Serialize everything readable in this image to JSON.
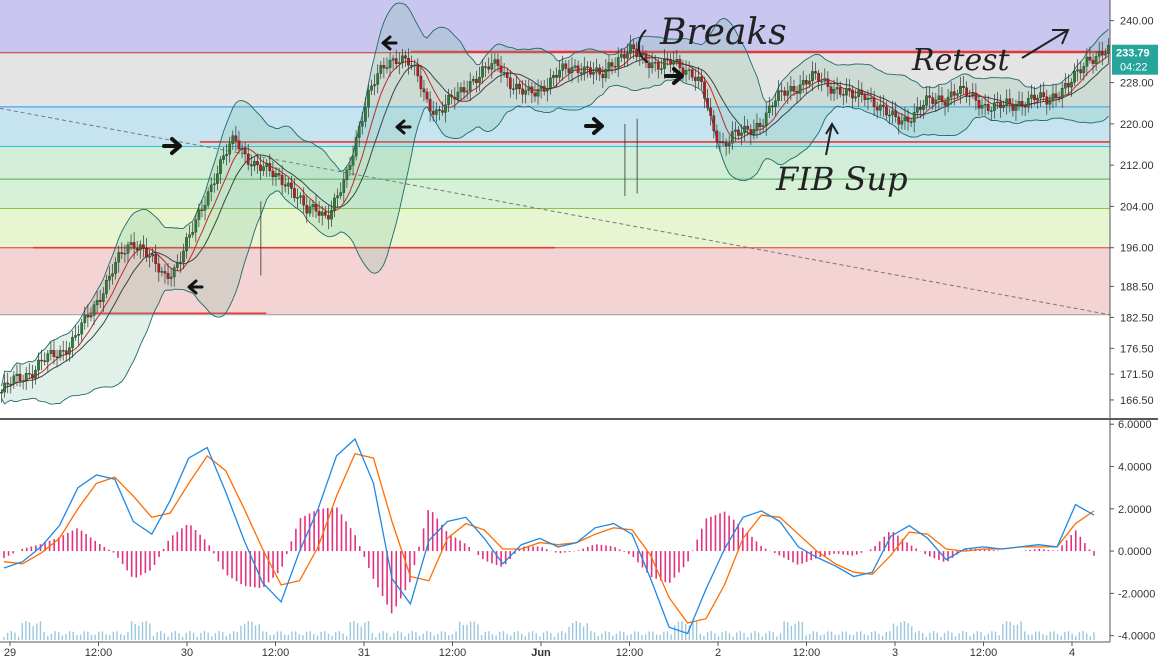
{
  "chart_data": {
    "type": "candlestick",
    "price_axis": {
      "range": [
        163.0,
        244.0
      ],
      "ticks": [
        "240.00",
        "228.00",
        "220.00",
        "212.00",
        "204.00",
        "196.00",
        "188.50",
        "182.50",
        "176.50",
        "171.50",
        "166.50"
      ],
      "tick_values": [
        240.0,
        228.0,
        220.0,
        212.0,
        204.0,
        196.0,
        188.5,
        182.5,
        176.5,
        171.5,
        166.5
      ]
    },
    "time_axis": {
      "ticks": [
        "29",
        "12:00",
        "30",
        "12:00",
        "31",
        "12:00",
        "Jun",
        "12:00",
        "2",
        "12:00",
        "3",
        "12:00",
        "4"
      ],
      "bold": [
        "Jun"
      ]
    },
    "last_price": {
      "value": "233.79",
      "countdown": "04:22",
      "color": "#26a69a"
    },
    "fib_levels": [
      {
        "price": 233.79,
        "fill": "#c9c6f0",
        "color": "#d32f2f"
      },
      {
        "price": 223.3,
        "fill": "#e4e4e4",
        "color": "#2196f3"
      },
      {
        "price": 215.6,
        "fill": "#c6e4f0",
        "color": "#26c6da"
      },
      {
        "price": 209.3,
        "fill": "#d2edd8",
        "color": "#4caf50"
      },
      {
        "price": 203.6,
        "fill": "#d6f1d6",
        "color": "#8bc34a"
      },
      {
        "price": 196.0,
        "fill": "#e7f5d1",
        "color": "#e53935"
      },
      {
        "price": 183.0,
        "fill": "#f3d3d3",
        "color": "#9e9e9e"
      }
    ],
    "horizontal_lines": [
      {
        "price": 234.0,
        "from_date_index": 0.37,
        "color": "#e53935"
      },
      {
        "price": 216.5,
        "from_date_index": 0.18,
        "color": "#e53935"
      },
      {
        "price": 196.0,
        "from_date_index": 0.03,
        "to_date_index": 0.5,
        "color": "#e53935"
      },
      {
        "price": 183.3,
        "from_date_index": 0.08,
        "to_date_index": 0.24,
        "color": "#e53935"
      }
    ],
    "trend_line": {
      "from": [
        0.0,
        223.0
      ],
      "to": [
        1.0,
        183.0
      ],
      "style": "dashed",
      "color": "#777777"
    },
    "close_path": [
      168,
      170,
      171,
      172,
      174,
      175,
      176,
      178,
      181,
      184,
      188,
      192,
      195,
      197,
      196,
      193,
      190,
      192,
      196,
      200,
      205,
      210,
      214,
      217,
      214,
      212,
      211,
      210,
      209,
      206,
      203,
      204,
      202,
      205,
      210,
      218,
      225,
      229,
      232,
      233,
      232,
      229,
      224,
      222,
      224,
      226,
      228,
      229,
      231,
      232,
      228,
      226,
      226,
      227,
      228,
      230,
      231,
      231,
      230,
      229,
      232,
      233,
      234,
      233,
      232,
      231,
      232,
      231,
      230,
      227,
      219,
      216,
      218,
      218,
      219,
      221,
      224,
      226,
      227,
      228,
      229,
      228,
      227,
      226,
      225,
      226,
      224,
      222,
      221,
      221,
      222,
      224,
      225,
      225,
      226,
      226,
      225,
      223,
      223,
      224,
      224,
      224,
      225,
      225,
      226,
      227,
      230,
      233,
      233,
      234
    ],
    "annotations": [
      "Breaks",
      "Retest",
      "FIB Sup"
    ],
    "macd": {
      "axis_ticks": [
        "6.0000",
        "4.0000",
        "2.0000",
        "0.0000",
        "-2.0000",
        "-4.0000"
      ],
      "axis_values": [
        6,
        4,
        2,
        0,
        -2,
        -4
      ],
      "range": [
        -4.3,
        6.2
      ],
      "macd_line": [
        -0.8,
        -0.5,
        0.2,
        1.2,
        3.0,
        3.6,
        3.4,
        1.4,
        0.8,
        2.4,
        4.4,
        4.9,
        2.8,
        0.5,
        -1.5,
        -2.4,
        0.0,
        2.0,
        4.5,
        5.3,
        3.2,
        -1.3,
        -2.5,
        0.5,
        1.4,
        1.6,
        0.6,
        -0.6,
        0.3,
        0.6,
        0.2,
        0.4,
        1.1,
        1.3,
        0.8,
        -1.3,
        -3.6,
        -3.9,
        -1.8,
        0.1,
        1.6,
        1.9,
        1.4,
        0.2,
        -0.3,
        -0.7,
        -1.2,
        -1.0,
        0.7,
        1.2,
        0.6,
        -0.4,
        0.1,
        0.2,
        0.1,
        0.2,
        0.3,
        0.2,
        2.2,
        1.7
      ],
      "signal_line": [
        -0.5,
        -0.6,
        -0.1,
        0.6,
        2.0,
        3.2,
        3.5,
        2.6,
        1.6,
        1.8,
        3.2,
        4.5,
        3.8,
        2.0,
        0.1,
        -1.6,
        -1.4,
        0.2,
        2.6,
        4.6,
        4.4,
        1.4,
        -1.2,
        -1.4,
        0.6,
        1.3,
        1.0,
        0.1,
        0.1,
        0.4,
        0.3,
        0.4,
        0.8,
        1.1,
        1.0,
        -0.2,
        -2.2,
        -3.4,
        -3.2,
        -1.6,
        0.6,
        1.7,
        1.6,
        0.8,
        0.0,
        -0.6,
        -1.0,
        -1.1,
        -0.2,
        0.9,
        0.8,
        0.1,
        0.0,
        0.1,
        0.1,
        0.2,
        0.2,
        0.2,
        1.3,
        1.9
      ]
    }
  }
}
